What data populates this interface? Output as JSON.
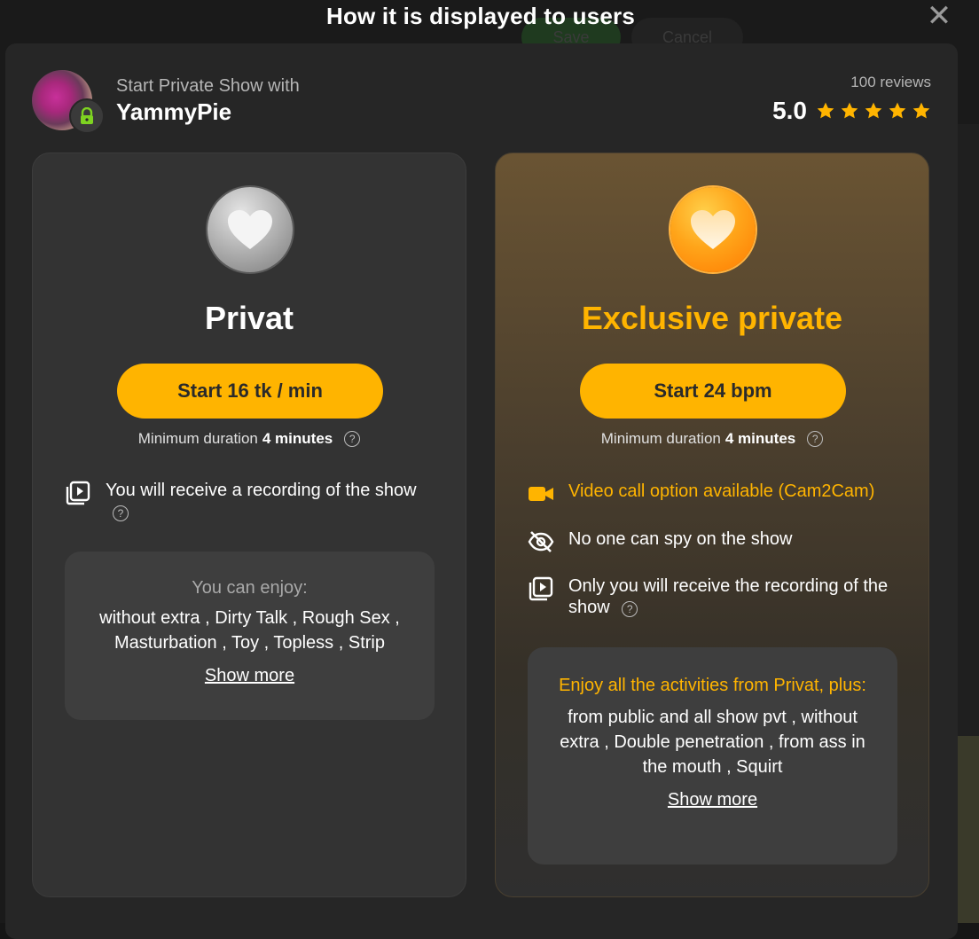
{
  "background": {
    "save_label": "Save",
    "cancel_label": "Cancel"
  },
  "overlay": {
    "title": "How it is displayed to users",
    "close_icon": "close-icon"
  },
  "header": {
    "subtitle": "Start Private Show with",
    "host_name": "YammyPie",
    "reviews": "100 reviews",
    "rating": "5.0",
    "stars": 5
  },
  "cards": [
    {
      "title": "Privat",
      "button_label": "Start 16 tk / min",
      "min_duration_label": "Minimum duration",
      "min_duration_value": "4 minutes",
      "features": [
        {
          "icon": "video-playlist-icon",
          "text": "You will receive a recording of the show",
          "help": true
        }
      ],
      "enjoy_heading": "You can enjoy:",
      "enjoy_list": "without extra , Dirty Talk , Rough Sex , Masturbation , Toy , Topless , Strip",
      "show_more": "Show more"
    },
    {
      "title": "Exclusive private",
      "button_label": "Start 24 bpm",
      "min_duration_label": "Minimum duration",
      "min_duration_value": "4 minutes",
      "features": [
        {
          "icon": "video-camera-icon",
          "text": "Video call option available (Cam2Cam)",
          "help": false
        },
        {
          "icon": "eye-off-icon",
          "text": "No one can spy on the show",
          "help": false
        },
        {
          "icon": "video-playlist-icon",
          "text": "Only you will receive the recording of the show",
          "help": true
        }
      ],
      "enjoy_heading": "Enjoy all the activities from Privat, plus:",
      "enjoy_list": "from public and all show pvt , without extra , Double penetration , from ass in the mouth , Squirt",
      "show_more": "Show more"
    }
  ],
  "colors": {
    "accent": "#ffb400",
    "modal_bg": "#262626",
    "card_bg": "#333333"
  }
}
